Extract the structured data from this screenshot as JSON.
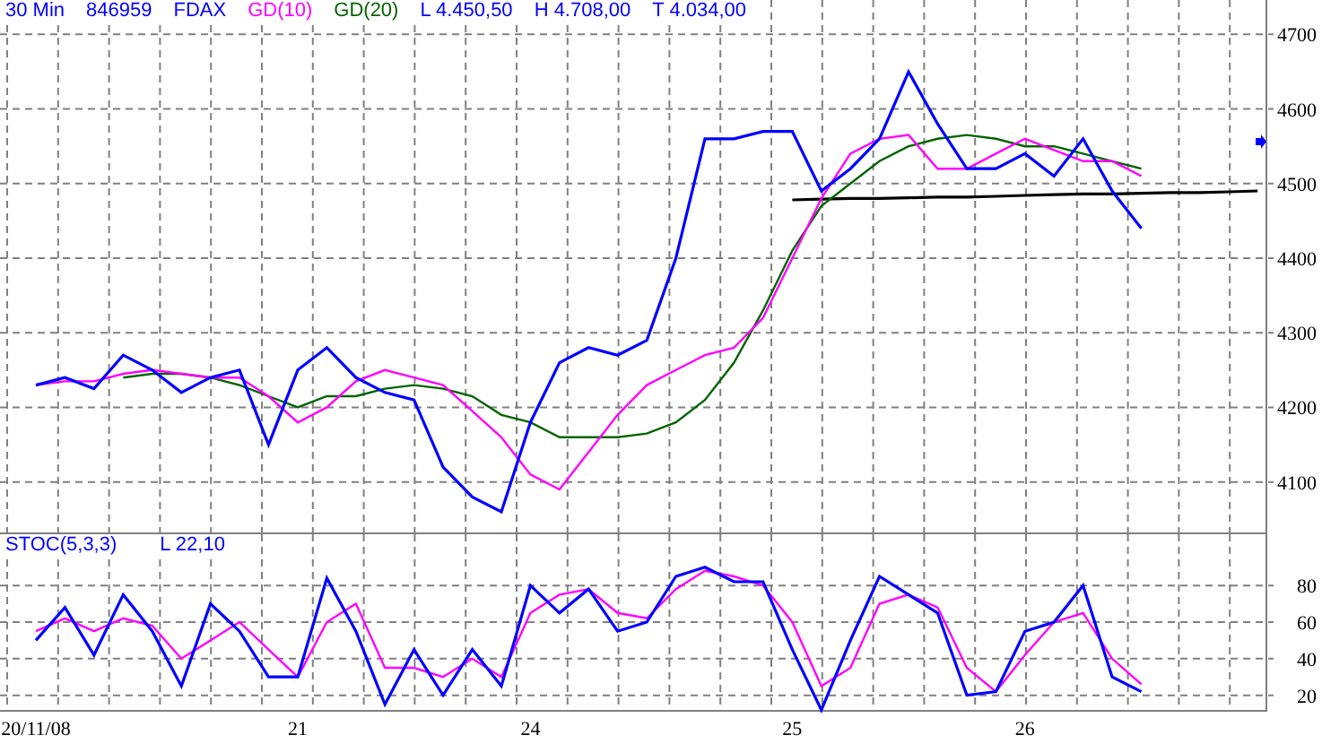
{
  "price_pane": {
    "interval": "30 Min",
    "code": "846959",
    "stats": [
      "L 4.450,50",
      "H 4.708,00",
      "T 4.034,00"
    ],
    "chart_data": {
      "type": "line",
      "categories": [
        null,
        null,
        null,
        null,
        null,
        null,
        null,
        null,
        null,
        null,
        null,
        null,
        null,
        null,
        null,
        null,
        null,
        null,
        null,
        null,
        null,
        null,
        null,
        null,
        null,
        null,
        null,
        null,
        null,
        null,
        null,
        null,
        null,
        null,
        null,
        null,
        null,
        null,
        null,
        null,
        null,
        null,
        null
      ],
      "grid": true,
      "ylim": [
        4030,
        4746
      ],
      "yticks": [
        4100,
        4200,
        4300,
        4400,
        4500,
        4600,
        4700
      ],
      "series": [
        {
          "name": "FDAX",
          "color": "#0000ff",
          "values": [
            4230,
            4240,
            4225,
            4270,
            4250,
            4220,
            4240,
            4250,
            4150,
            4250,
            4280,
            4240,
            4220,
            4210,
            4120,
            4080,
            4060,
            4180,
            4260,
            4280,
            4270,
            4290,
            4400,
            4560,
            4560,
            4570,
            4570,
            4490,
            4520,
            4560,
            4650,
            4580,
            4520,
            4520,
            4540,
            4510,
            4560,
            4490,
            4440,
            null,
            null,
            null,
            null
          ]
        },
        {
          "name": "GD(10)",
          "color": "#ff00ff",
          "values": [
            4230,
            4235,
            4235,
            4245,
            4250,
            4245,
            4240,
            4240,
            4215,
            4180,
            4200,
            4235,
            4250,
            4240,
            4230,
            4195,
            4160,
            4110,
            4090,
            4140,
            4190,
            4230,
            4250,
            4270,
            4280,
            4320,
            4400,
            4480,
            4540,
            4560,
            4565,
            4520,
            4520,
            4540,
            4560,
            4545,
            4530,
            4530,
            4510,
            null,
            null,
            null,
            null
          ]
        },
        {
          "name": "GD(20)",
          "color": "#006400",
          "values": [
            null,
            null,
            null,
            4240,
            4245,
            4245,
            4240,
            4230,
            4215,
            4200,
            4215,
            4215,
            4225,
            4230,
            4225,
            4215,
            4190,
            4180,
            4160,
            4160,
            4160,
            4165,
            4180,
            4210,
            4260,
            4330,
            4410,
            4470,
            4500,
            4530,
            4550,
            4560,
            4565,
            4560,
            4550,
            4550,
            4540,
            4530,
            4520,
            null,
            null,
            null,
            null
          ]
        },
        {
          "color": "#000000",
          "values": [
            null,
            null,
            null,
            null,
            null,
            null,
            null,
            null,
            null,
            null,
            null,
            null,
            null,
            null,
            null,
            null,
            null,
            null,
            null,
            null,
            null,
            null,
            null,
            null,
            null,
            null,
            4478,
            4479,
            4480,
            4480,
            4481,
            4482,
            4482,
            4483,
            4484,
            4485,
            4486,
            4486,
            4487,
            4488,
            4488,
            4489,
            4490
          ]
        }
      ]
    }
  },
  "stochastic_pane": {
    "reading": "L 22,10",
    "chart_data": {
      "type": "line",
      "title": "STOC(5,3,3)",
      "categories": [
        "20/11/08",
        null,
        null,
        null,
        null,
        null,
        null,
        null,
        null,
        "21",
        null,
        null,
        null,
        null,
        null,
        null,
        null,
        "24",
        null,
        null,
        null,
        null,
        null,
        null,
        null,
        null,
        "25",
        null,
        null,
        null,
        null,
        null,
        null,
        null,
        "26",
        null,
        null,
        null,
        null
      ],
      "grid": true,
      "ylim": [
        11,
        108
      ],
      "yticks": [
        20,
        40,
        60,
        80
      ],
      "series": [
        {
          "color": "#0000ff",
          "values": [
            50,
            68,
            42,
            75,
            55,
            25,
            70,
            55,
            30,
            30,
            84,
            55,
            15,
            45,
            20,
            45,
            25,
            80,
            65,
            78,
            55,
            60,
            85,
            90,
            82,
            82,
            45,
            12,
            50,
            85,
            75,
            65,
            20,
            22,
            55,
            60,
            80,
            30,
            22
          ]
        },
        {
          "color": "#ff00ff",
          "values": [
            55,
            62,
            55,
            62,
            58,
            40,
            50,
            60,
            45,
            30,
            60,
            70,
            35,
            35,
            30,
            40,
            30,
            65,
            75,
            78,
            65,
            62,
            78,
            88,
            85,
            80,
            60,
            25,
            35,
            70,
            75,
            68,
            35,
            22,
            42,
            60,
            65,
            40,
            26
          ]
        }
      ]
    }
  }
}
